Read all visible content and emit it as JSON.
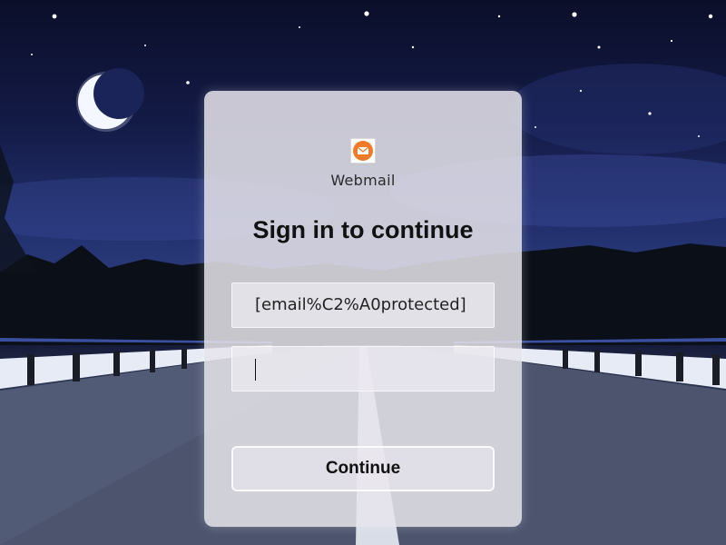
{
  "app": {
    "brand_name": "Webmail",
    "logo_icon": "envelope-icon",
    "logo_color": "#f07b2a"
  },
  "login": {
    "heading": "Sign in to continue",
    "email_value": "[email%C2%A0protected]",
    "password_value": "",
    "continue_label": "Continue"
  },
  "background": {
    "description_icon": "night-road-moon-background"
  }
}
